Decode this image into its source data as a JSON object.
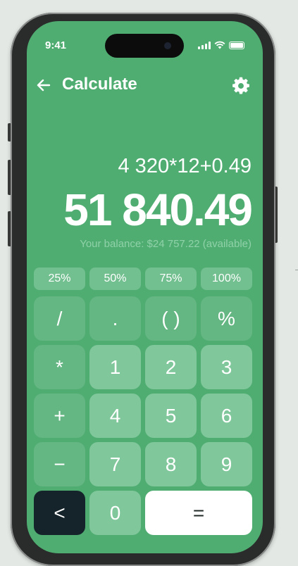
{
  "status_bar": {
    "time": "9:41"
  },
  "header": {
    "title": "Calculate",
    "back_icon": "arrow-left-icon",
    "settings_icon": "gear-icon"
  },
  "display": {
    "expression": "4 320*12+0.49",
    "result": "51 840.49",
    "balance": "Your balance: $24 757.22 (available)"
  },
  "percent_buttons": [
    "25%",
    "50%",
    "75%",
    "100%"
  ],
  "keypad": {
    "row1": [
      "/",
      ".",
      "( )",
      "%"
    ],
    "row2": [
      "*",
      "1",
      "2",
      "3"
    ],
    "row3": [
      "+",
      "4",
      "5",
      "6"
    ],
    "row4": [
      "−",
      "7",
      "8",
      "9"
    ],
    "row5": {
      "back": "<",
      "zero": "0",
      "equals": "="
    }
  },
  "colors": {
    "screen_bg": "#50ad72",
    "number_key": "#80c79b",
    "operator_key": "#64b683",
    "back_key": "#15242a",
    "equals_key": "#ffffff"
  }
}
